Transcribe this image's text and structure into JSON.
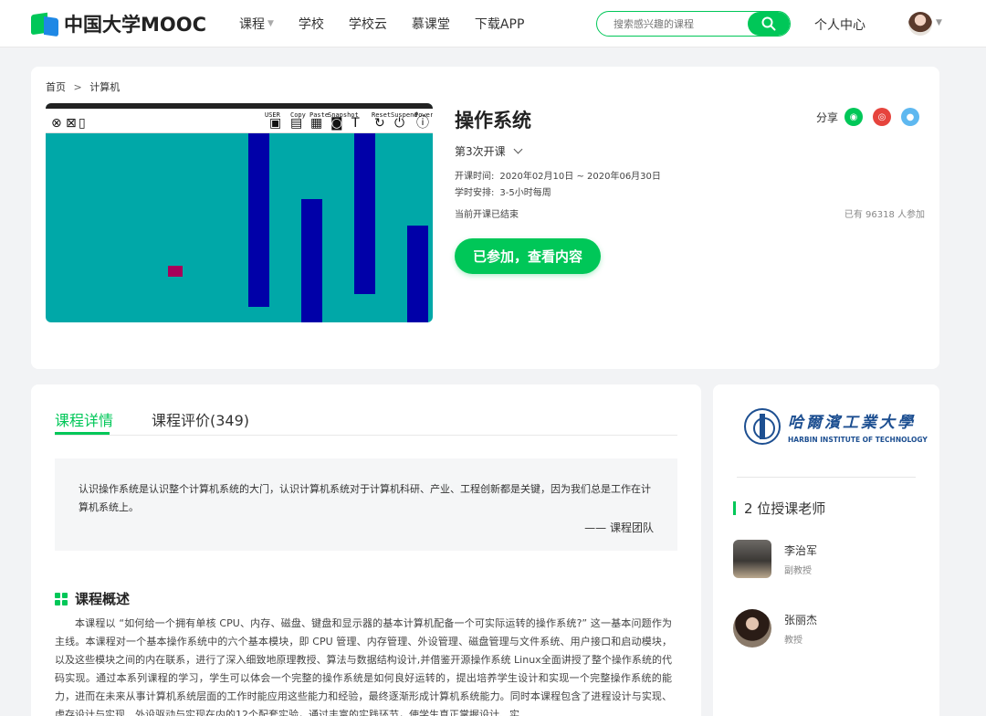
{
  "header": {
    "logo_text": "中国大学MOOC",
    "nav": [
      {
        "label": "课程",
        "has_dropdown": true
      },
      {
        "label": "学校",
        "has_dropdown": false
      },
      {
        "label": "学校云",
        "has_dropdown": false
      },
      {
        "label": "慕课堂",
        "has_dropdown": false
      },
      {
        "label": "下载APP",
        "has_dropdown": false
      }
    ],
    "search_placeholder": "搜索感兴趣的课程",
    "user_center": "个人中心"
  },
  "breadcrumb": {
    "home": "首页",
    "separator": ">",
    "current": "计算机"
  },
  "course": {
    "image_toolbar_labels": [
      "USER",
      "Copy",
      "Paste",
      "Snapshot",
      "Reset",
      "Suspend",
      "Power",
      "CONFIG"
    ],
    "title": "操作系统",
    "share_label": "分享",
    "session": "第3次开课",
    "time_label": "开课时间:",
    "time_value": "2020年02月10日 ~ 2020年06月30日",
    "schedule_label": "学时安排:",
    "schedule_value": "3-5小时每周",
    "status": "当前开课已结束",
    "participants": "已有 96318 人参加",
    "join_button": "已参加，查看内容"
  },
  "details": {
    "tabs": [
      "课程详情",
      "课程评价(349)"
    ],
    "active_tab": 0,
    "quote": "认识操作系统是认识整个计算机系统的大门，认识计算机系统对于计算机科研、产业、工程创新都是关键，因为我们总是工作在计算机系统上。",
    "quote_sign": "—— 课程团队",
    "overview_title": "课程概述",
    "overview_text": "本课程以 “如何给一个拥有单核 CPU、内存、磁盘、键盘和显示器的基本计算机配备一个可实际运转的操作系统?” 这一基本问题作为主线。本课程对一个基本操作系统中的六个基本模块，即 CPU 管理、内存管理、外设管理、磁盘管理与文件系统、用户接口和启动模块，以及这些模块之间的内在联系，进行了深入细致地原理教授、算法与数据结构设计,并借鉴开源操作系统 Linux全面讲授了整个操作系统的代码实现。通过本系列课程的学习，学生可以体会一个完整的操作系统是如何良好运转的，提出培养学生设计和实现一个完整操作系统的能力，进而在未来从事计算机系统层面的工作时能应用这些能力和经验，最终逐渐形成计算机系统能力。同时本课程包含了进程设计与实现、虚存设计与实现、外设驱动与实现在内的12个配套实验，通过丰富的实践环节，使学生真正掌握设计、实"
  },
  "side": {
    "university_cn": "哈爾濱工業大學",
    "university_en": "HARBIN INSTITUTE OF TECHNOLOGY",
    "teachers_title": "2 位授课老师",
    "teachers": [
      {
        "name": "李治军",
        "title": "副教授"
      },
      {
        "name": "张丽杰",
        "title": "教授"
      }
    ]
  },
  "colors": {
    "accent": "#00c758",
    "brand_blue": "#1e88e5",
    "wechat": "#00c758",
    "weibo": "#e6443d",
    "qq": "#5eb8f0",
    "university_blue": "#1d4f91",
    "screen_teal": "#00a8a8",
    "screen_bar": "#0000a8",
    "screen_dot": "#a8005a"
  }
}
